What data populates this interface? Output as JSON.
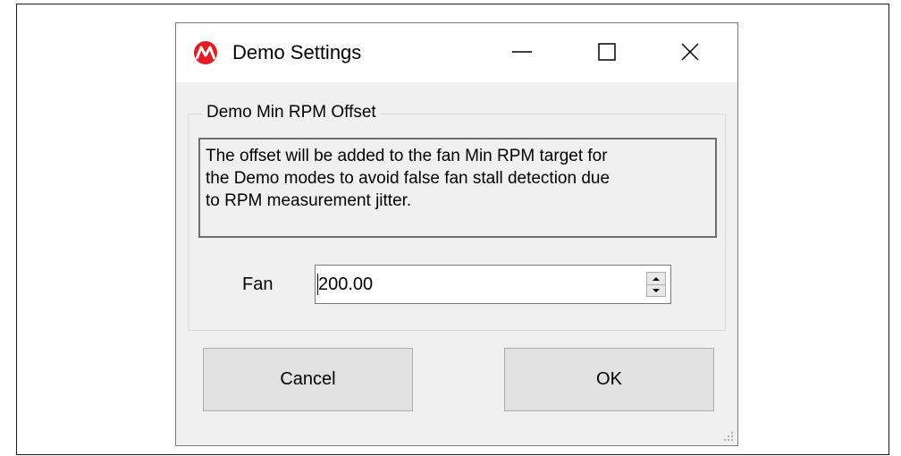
{
  "window": {
    "title": "Demo Settings",
    "icon": "microchip-logo-icon",
    "controls": [
      "minimize-icon",
      "maximize-icon",
      "close-icon"
    ]
  },
  "group": {
    "title": "Demo Min RPM Offset",
    "description_lines": [
      "The offset will be added to the fan Min RPM target for",
      "the Demo modes to avoid false fan stall detection due",
      "to RPM measurement jitter."
    ]
  },
  "fan": {
    "label": "Fan",
    "value": "200.00"
  },
  "buttons": {
    "cancel": "Cancel",
    "ok": "OK"
  },
  "colors": {
    "brand_red": "#e31b23",
    "dialog_bg": "#f0f0f0",
    "button_bg": "#e1e1e1"
  }
}
